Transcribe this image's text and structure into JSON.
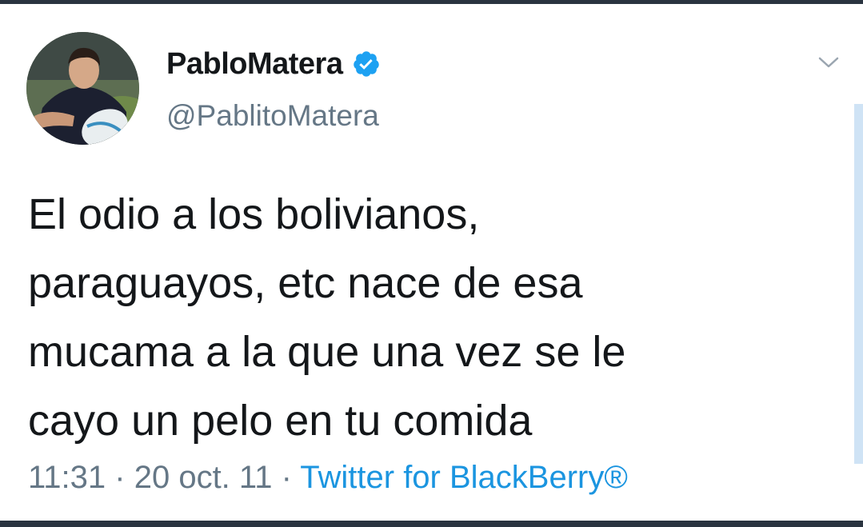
{
  "colors": {
    "text": "#14171a",
    "secondary": "#657786",
    "link": "#1b95e0",
    "verified": "#1da1f2",
    "frame": "#2a3440"
  },
  "tweet": {
    "author": {
      "display_name": "PabloMatera",
      "handle": "@PablitoMatera",
      "verified_icon": "verified-badge-icon",
      "avatar": "rugby-player-avatar"
    },
    "menu_icon": "chevron-down-icon",
    "text_lines": [
      "El odio a los bolivianos,",
      "paraguayos, etc nace de esa",
      "mucama a la que una vez se le",
      "cayo un pelo en tu comida"
    ],
    "time": "11:31",
    "separator": "·",
    "date": "20 oct. 11",
    "source": "Twitter for BlackBerry®"
  }
}
